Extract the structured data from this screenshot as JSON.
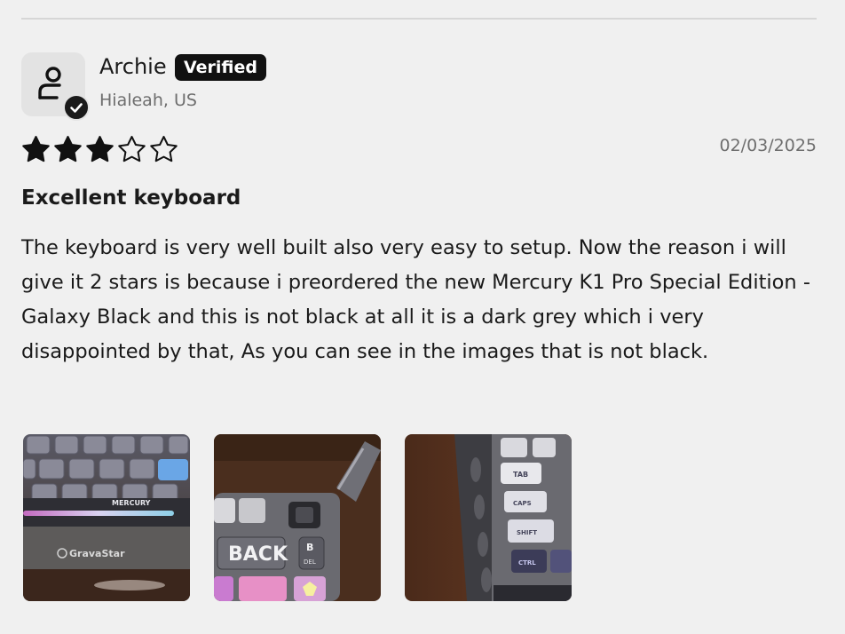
{
  "reviewer": {
    "name": "Archie",
    "verified_label": "Verified",
    "location": "Hialeah, US",
    "avatar_icon": "user-check-icon"
  },
  "review": {
    "rating": 3,
    "rating_max": 5,
    "date": "02/03/2025",
    "title": "Excellent keyboard",
    "body": "The keyboard is very well built also very easy to setup. Now the reason i will give it 2 stars is because i preordered the new Mercury K1 Pro Special Edition - Galaxy Black and this is not black at all it is a dark grey which i very disappointed by that, As you can see in the images that is not black."
  },
  "photos": [
    {
      "name": "review-photo-1",
      "labels": [
        "MERCURY",
        "GravaStar"
      ]
    },
    {
      "name": "review-photo-2",
      "labels": [
        "BACK",
        "B",
        "DEL"
      ]
    },
    {
      "name": "review-photo-3",
      "labels": [
        "TAB",
        "CAPS",
        "SHIFT",
        "CTRL"
      ]
    }
  ],
  "colors": {
    "background": "#f0f0f0",
    "badge": "#111111",
    "muted_text": "#6e6e6e",
    "star": "#111111"
  }
}
